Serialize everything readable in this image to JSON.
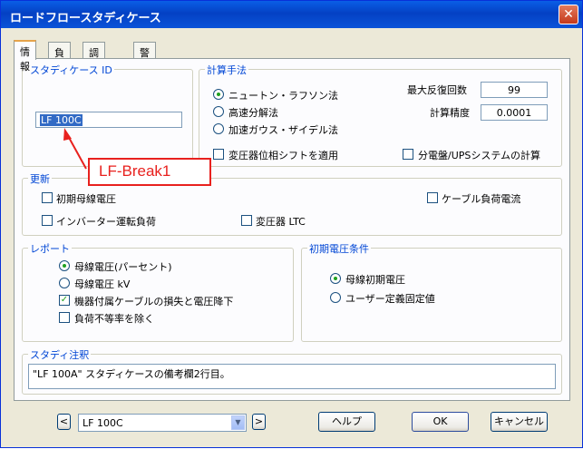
{
  "window": {
    "title": "ロードフロースタディケース",
    "close_glyph": "✕"
  },
  "tabs": [
    {
      "label": "情報",
      "active": true
    },
    {
      "label": "負荷",
      "active": false
    },
    {
      "label": "調整",
      "active": false
    },
    {
      "label": "警報",
      "active": false
    }
  ],
  "study_case": {
    "legend": "スタディケース ID",
    "value": "LF 100C"
  },
  "calc_method": {
    "legend": "計算手法",
    "options": [
      {
        "label": "ニュートン・ラフソン法",
        "selected": true
      },
      {
        "label": "高速分解法",
        "selected": false
      },
      {
        "label": "加速ガウス・ザイデル法",
        "selected": false
      }
    ],
    "max_iter_label": "最大反復回数",
    "max_iter_value": "99",
    "precision_label": "計算精度",
    "precision_value": "0.0001",
    "transformer_shift": {
      "label": "変圧器位相シフトを適用",
      "checked": false
    },
    "panel_calc": {
      "label": "分電盤/UPSシステムの計算",
      "checked": false
    }
  },
  "update": {
    "legend": "更新",
    "initial_bus_voltage": {
      "label": "初期母線電圧",
      "checked": false
    },
    "cable_load_current": {
      "label": "ケーブル負荷電流",
      "checked": false
    },
    "inverter_load": {
      "label": "インバーター運転負荷",
      "checked": false
    },
    "transformer_ltc": {
      "label": "変圧器 LTC",
      "checked": false
    }
  },
  "report": {
    "legend": "レポート",
    "options": [
      {
        "label": "母線電圧(パーセント)",
        "selected": true
      },
      {
        "label": "母線電圧 kV",
        "selected": false
      }
    ],
    "cable_loss": {
      "label": "機器付属ケーブルの損失と電圧降下",
      "checked": true
    },
    "exclude_diversity": {
      "label": "負荷不等率を除く",
      "checked": false
    }
  },
  "initial_voltage": {
    "legend": "初期電圧条件",
    "options": [
      {
        "label": "母線初期電圧",
        "selected": true
      },
      {
        "label": "ユーザー定義固定値",
        "selected": false
      }
    ]
  },
  "remarks": {
    "legend": "スタディ注釈",
    "text": "\"LF 100A\" スタディケースの備考欄2行目。"
  },
  "footer": {
    "prev_glyph": "<",
    "next_glyph": ">",
    "case_select": "LF 100C",
    "help": "ヘルプ",
    "ok": "OK",
    "cancel": "キャンセル"
  },
  "annotation": {
    "text": "LF-Break1",
    "color": "#e8211e"
  }
}
